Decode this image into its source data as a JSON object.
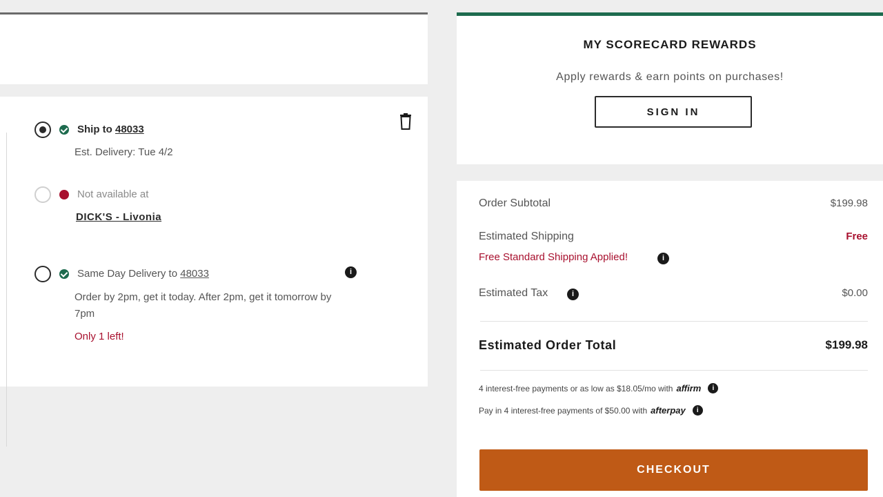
{
  "fulfillment": {
    "ship": {
      "label_prefix": "Ship to",
      "zip": "48033",
      "delivery": "Est. Delivery: Tue 4/2"
    },
    "pickup": {
      "label": "Not available at",
      "store": "DICK'S - Livonia"
    },
    "same_day": {
      "label_prefix": "Same Day Delivery to",
      "zip": "48033",
      "description": "Order by 2pm, get it today. After 2pm, get it tomorrow by 7pm",
      "stock": "Only 1 left!"
    }
  },
  "rewards": {
    "title": "MY SCORECARD REWARDS",
    "subtitle": "Apply rewards & earn points on purchases!",
    "sign_in": "SIGN IN"
  },
  "summary": {
    "subtotal_label": "Order Subtotal",
    "subtotal_value": "$199.98",
    "shipping_label": "Estimated Shipping",
    "shipping_value": "Free",
    "shipping_promo": "Free Standard Shipping Applied!",
    "tax_label": "Estimated Tax",
    "tax_value": "$0.00",
    "total_label": "Estimated Order Total",
    "total_value": "$199.98",
    "affirm_text": "4 interest-free payments or as low as $18.05/mo with",
    "affirm_brand": "affirm",
    "afterpay_text": "Pay in 4 interest-free payments of $50.00 with",
    "afterpay_brand": "afterpay",
    "checkout": "CHECKOUT"
  },
  "colors": {
    "accent_green": "#1d6b4e",
    "alert_red": "#a8102e",
    "checkout_orange": "#bf5a16"
  }
}
